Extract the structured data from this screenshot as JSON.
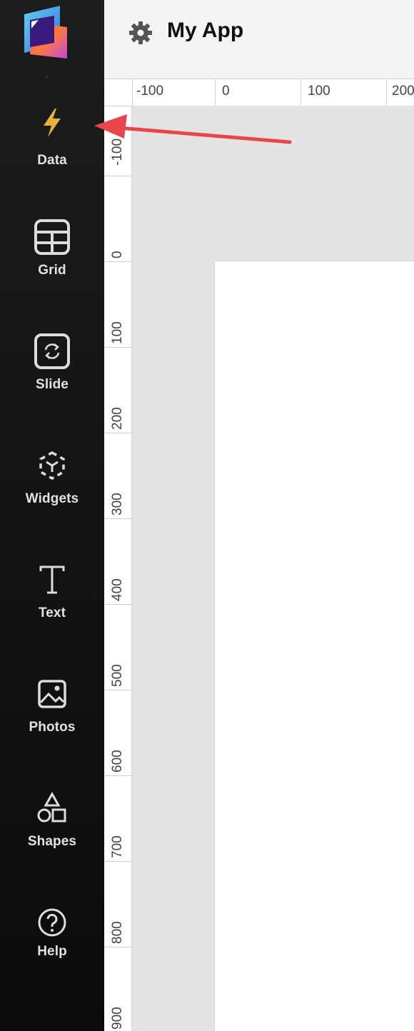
{
  "header": {
    "title": "My App",
    "settings_icon": "gear-icon"
  },
  "sidebar": {
    "logo": "app-logo",
    "items": [
      {
        "label": "Data",
        "icon": "lightning-icon",
        "active": true
      },
      {
        "label": "Grid",
        "icon": "grid-icon"
      },
      {
        "label": "Slide",
        "icon": "slide-refresh-icon"
      },
      {
        "label": "Widgets",
        "icon": "widgets-icon"
      },
      {
        "label": "Text",
        "icon": "text-t-icon"
      },
      {
        "label": "Photos",
        "icon": "photo-icon"
      },
      {
        "label": "Shapes",
        "icon": "shapes-icon"
      },
      {
        "label": "Help",
        "icon": "help-question-icon"
      }
    ]
  },
  "ruler": {
    "horizontal": [
      "-100",
      "0",
      "100",
      "200"
    ],
    "vertical": [
      "-100",
      "0",
      "100",
      "200",
      "300",
      "400",
      "500",
      "600",
      "700",
      "800",
      "900"
    ]
  },
  "colors": {
    "sidebar_bg": "#141414",
    "active_icon": "#e7b23a",
    "annotation_arrow": "#e8464b"
  }
}
